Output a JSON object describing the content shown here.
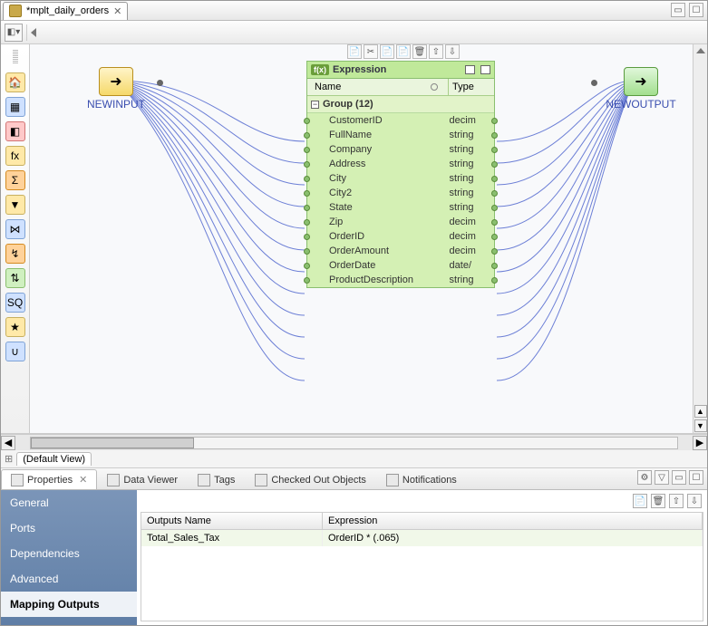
{
  "tab": {
    "title": "*mplt_daily_orders"
  },
  "defaultView": {
    "label": "(Default View)"
  },
  "nodes": {
    "input": {
      "label": "NEWINPUT"
    },
    "output": {
      "label": "NEWOUTPUT"
    },
    "expression": {
      "title": "Expression",
      "nameHeader": "Name",
      "typeHeader": "Type",
      "groupLabel": "Group (12)",
      "rows": [
        {
          "name": "CustomerID",
          "type": "decim"
        },
        {
          "name": "FullName",
          "type": "string"
        },
        {
          "name": "Company",
          "type": "string"
        },
        {
          "name": "Address",
          "type": "string"
        },
        {
          "name": "City",
          "type": "string"
        },
        {
          "name": "City2",
          "type": "string"
        },
        {
          "name": "State",
          "type": "string"
        },
        {
          "name": "Zip",
          "type": "decim"
        },
        {
          "name": "OrderID",
          "type": "decim"
        },
        {
          "name": "OrderAmount",
          "type": "decim"
        },
        {
          "name": "OrderDate",
          "type": "date/"
        },
        {
          "name": "ProductDescription",
          "type": "string"
        }
      ]
    }
  },
  "bottomPanel": {
    "tabs": {
      "properties": "Properties",
      "dataViewer": "Data Viewer",
      "tags": "Tags",
      "checkedOut": "Checked Out Objects",
      "notifications": "Notifications"
    },
    "sidebar": {
      "general": "General",
      "ports": "Ports",
      "dependencies": "Dependencies",
      "advanced": "Advanced",
      "mappingOutputs": "Mapping Outputs"
    },
    "table": {
      "col1": "Outputs Name",
      "col2": "Expression",
      "row1": {
        "name": "Total_Sales_Tax",
        "expr": "OrderID * (.065)"
      }
    }
  },
  "toolbarIcons": {
    "copy": "⎘",
    "cut": "✂",
    "paste": "📄",
    "paste2": "📄",
    "delete": "🗑",
    "up": "⇧",
    "down": "⇩",
    "min": "▭",
    "max": "☐"
  }
}
